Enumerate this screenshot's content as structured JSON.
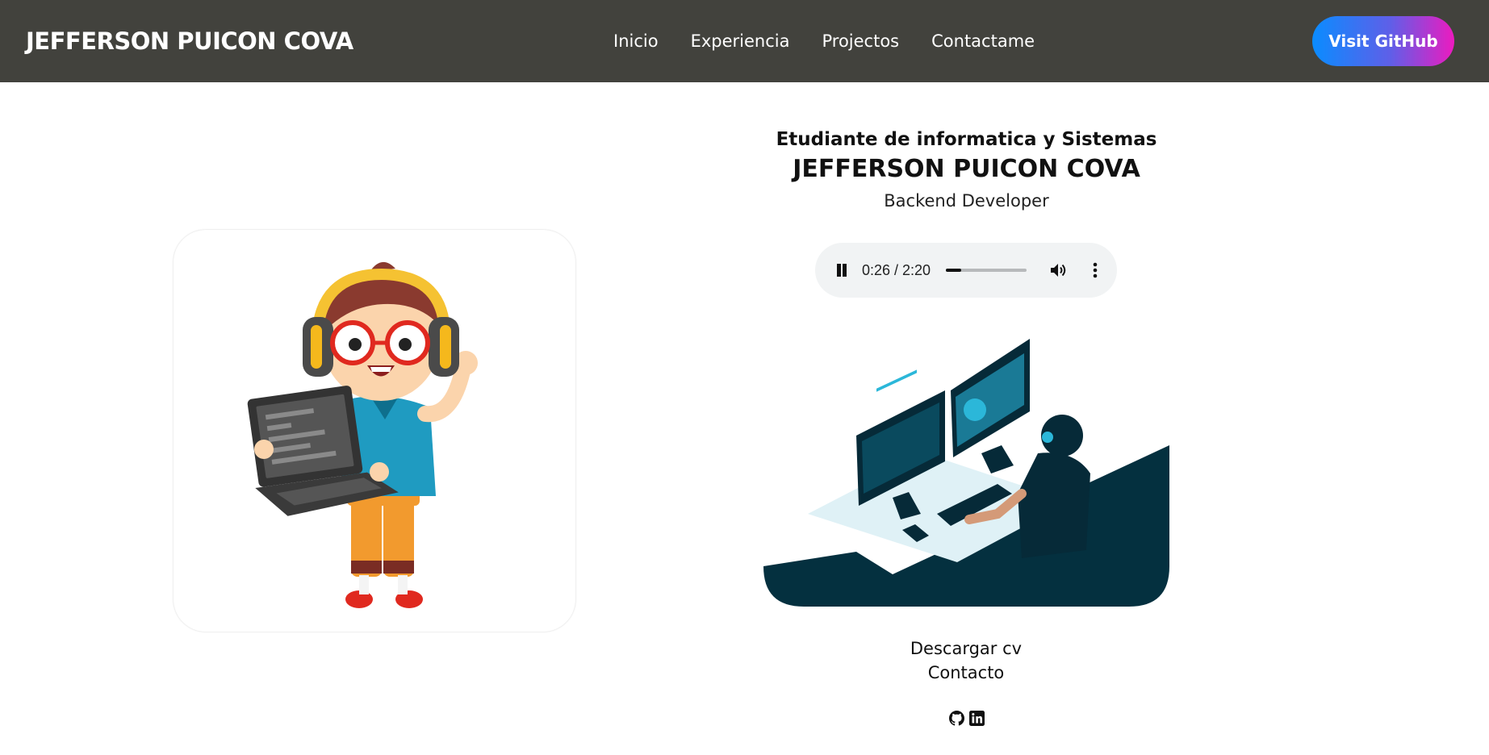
{
  "navbar": {
    "brand": "JEFFERSON PUICON COVA",
    "links": [
      "Inicio",
      "Experiencia",
      "Projectos",
      "Contactame"
    ],
    "cta": "Visit GitHub"
  },
  "hero": {
    "subtitle": "Etudiante de informatica y Sistemas",
    "name": "JEFFERSON PUICON COVA",
    "role": "Backend Developer"
  },
  "audio": {
    "time": "0:26 / 2:20",
    "progress": 0.186
  },
  "actions": {
    "cv": "Descargar cv",
    "contact": "Contacto"
  },
  "socials": [
    {
      "icon": "github-icon"
    },
    {
      "icon": "linkedin-icon"
    }
  ]
}
